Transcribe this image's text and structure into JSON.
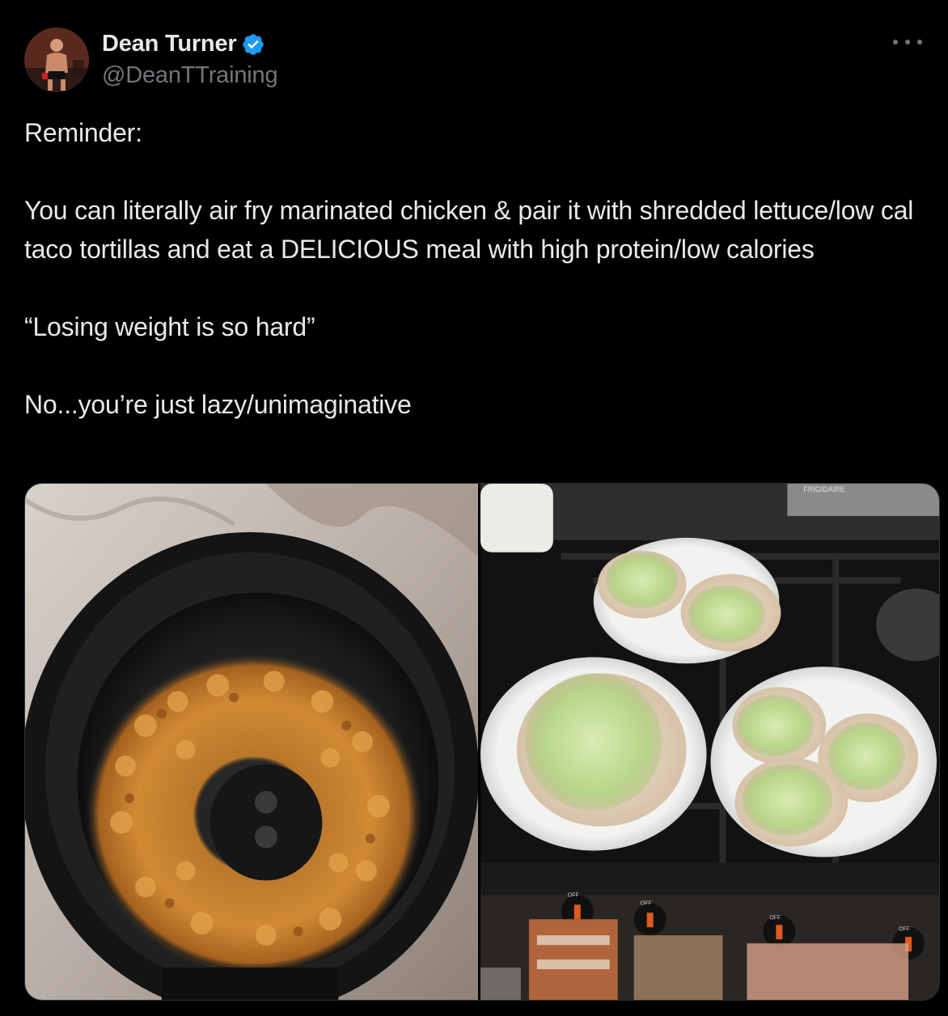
{
  "author": {
    "display_name": "Dean Turner",
    "handle": "@DeanTTraining",
    "verified": true,
    "avatar_icon": "profile-photo"
  },
  "tweet": {
    "lines": [
      "Reminder:",
      "",
      "You can literally air fry marinated chicken & pair it with shredded lettuce/low cal taco tortillas and eat a DELICIOUS meal with high protein/low calories",
      "",
      "“Losing weight is so hard”",
      "",
      "No...you’re just lazy/unimaginative"
    ]
  },
  "media": {
    "photos": [
      {
        "subject": "air fryer basket with seasoned chicken pieces"
      },
      {
        "subject": "plates of tortillas with shredded lettuce on stove"
      }
    ],
    "stove_brand_text": "FRIGIDAIRE",
    "knob_labels": [
      "OFF",
      "OFF",
      "OFF",
      "OFF"
    ]
  },
  "colors": {
    "background": "#000000",
    "text_primary": "#e7e9ea",
    "text_secondary": "#71767b",
    "verified_blue": "#1d9bf0",
    "border": "#2f3336"
  },
  "icons": {
    "more": "more-icon",
    "verified": "verified-badge-icon"
  }
}
